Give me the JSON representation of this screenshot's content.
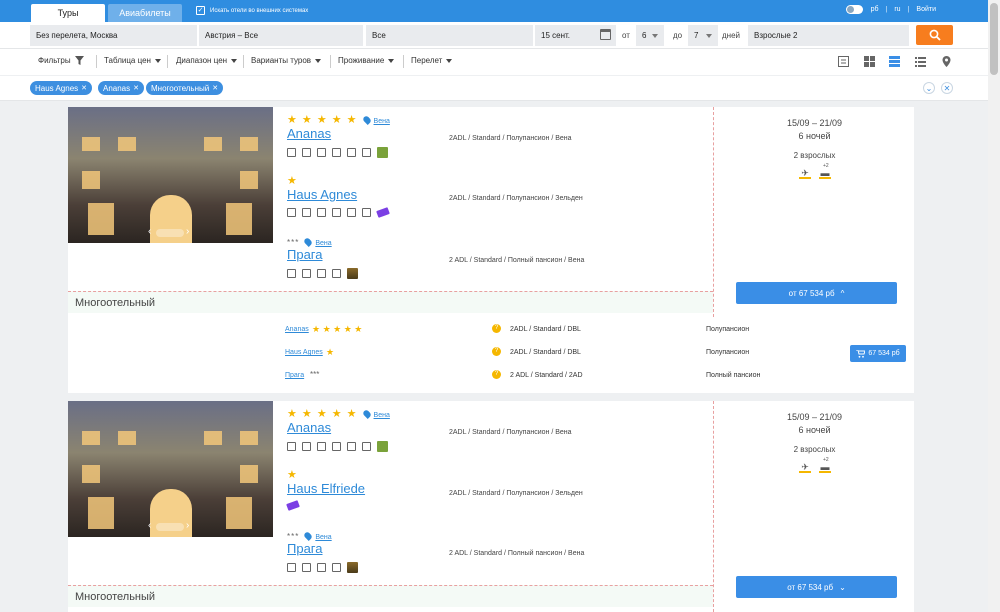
{
  "tabs": {
    "tours": "Туры",
    "avia": "Авиабилеты"
  },
  "external_search": "Искать отели во внешних системах",
  "header_right": {
    "currency": "рб",
    "lang": "ru",
    "login": "Войти"
  },
  "search": {
    "departure": "Без перелета, Москва",
    "country": "Австрия – Все",
    "resort": "Все",
    "date": "15 сент.",
    "from_label": "от",
    "nights_from": "6",
    "to_label": "до",
    "nights_to": "7",
    "days_label": "дней",
    "tourists": "Взрослые 2"
  },
  "toolbar": {
    "filters": "Фильтры",
    "price_table": "Таблица цен",
    "price_range": "Диапазон цен",
    "tour_variants": "Варианты туров",
    "accommodation": "Проживание",
    "flight": "Перелет"
  },
  "chips": [
    "Haus Agnes",
    "Ananas",
    "Многоотельный"
  ],
  "cards": [
    {
      "hotels": [
        {
          "stars": "★ ★ ★ ★ ★",
          "name": "Ananas",
          "city": "Вена",
          "room": "2ADL / Standard / Полупансион / Вена"
        },
        {
          "stars": "★",
          "name": "Haus Agnes",
          "city": "",
          "room": "2ADL / Standard / Полупансион / Зельден"
        },
        {
          "stars": "***",
          "name": "Прага",
          "city": "Вена",
          "room": "2 ADL / Standard / Полный пансион / Вена"
        }
      ],
      "dates": "15/09 – 21/09",
      "nights": "6 ночей",
      "adults": "2 взрослых",
      "price": "от 67 534 рб",
      "multi": "Многоотельный"
    },
    {
      "hotels": [
        {
          "stars": "★ ★ ★ ★ ★",
          "name": "Ananas",
          "city": "Вена",
          "room": "2ADL / Standard / Полупансион / Вена"
        },
        {
          "stars": "★",
          "name": "Haus Elfriede",
          "city": "",
          "room": "2ADL / Standard / Полупансион / Зельден"
        },
        {
          "stars": "***",
          "name": "Прага",
          "city": "Вена",
          "room": "2 ADL / Standard / Полный пансион / Вена"
        }
      ],
      "dates": "15/09 – 21/09",
      "nights": "6 ночей",
      "adults": "2 взрослых",
      "price": "от 67 534 рб",
      "multi": "Многоотельный"
    }
  ],
  "details": [
    {
      "name": "Ananas",
      "stars": "★ ★ ★ ★ ★",
      "room": "2ADL / Standard / DBL",
      "meal": "Полупансион"
    },
    {
      "name": "Haus Agnes",
      "stars": "★",
      "room": "2ADL / Standard / DBL",
      "meal": "Полупансион"
    },
    {
      "name": "Прага",
      "stars": "***",
      "room": "2 ADL / Standard / 2AD",
      "meal": "Полный пансион"
    }
  ],
  "detail_price": "67 534 рб",
  "transport_badge": "+2",
  "chevrons": {
    "up": "^",
    "down": "⌄"
  },
  "colors": {
    "primary": "#2f8de0",
    "accent": "#f77d1e",
    "star": "#f5b700"
  }
}
